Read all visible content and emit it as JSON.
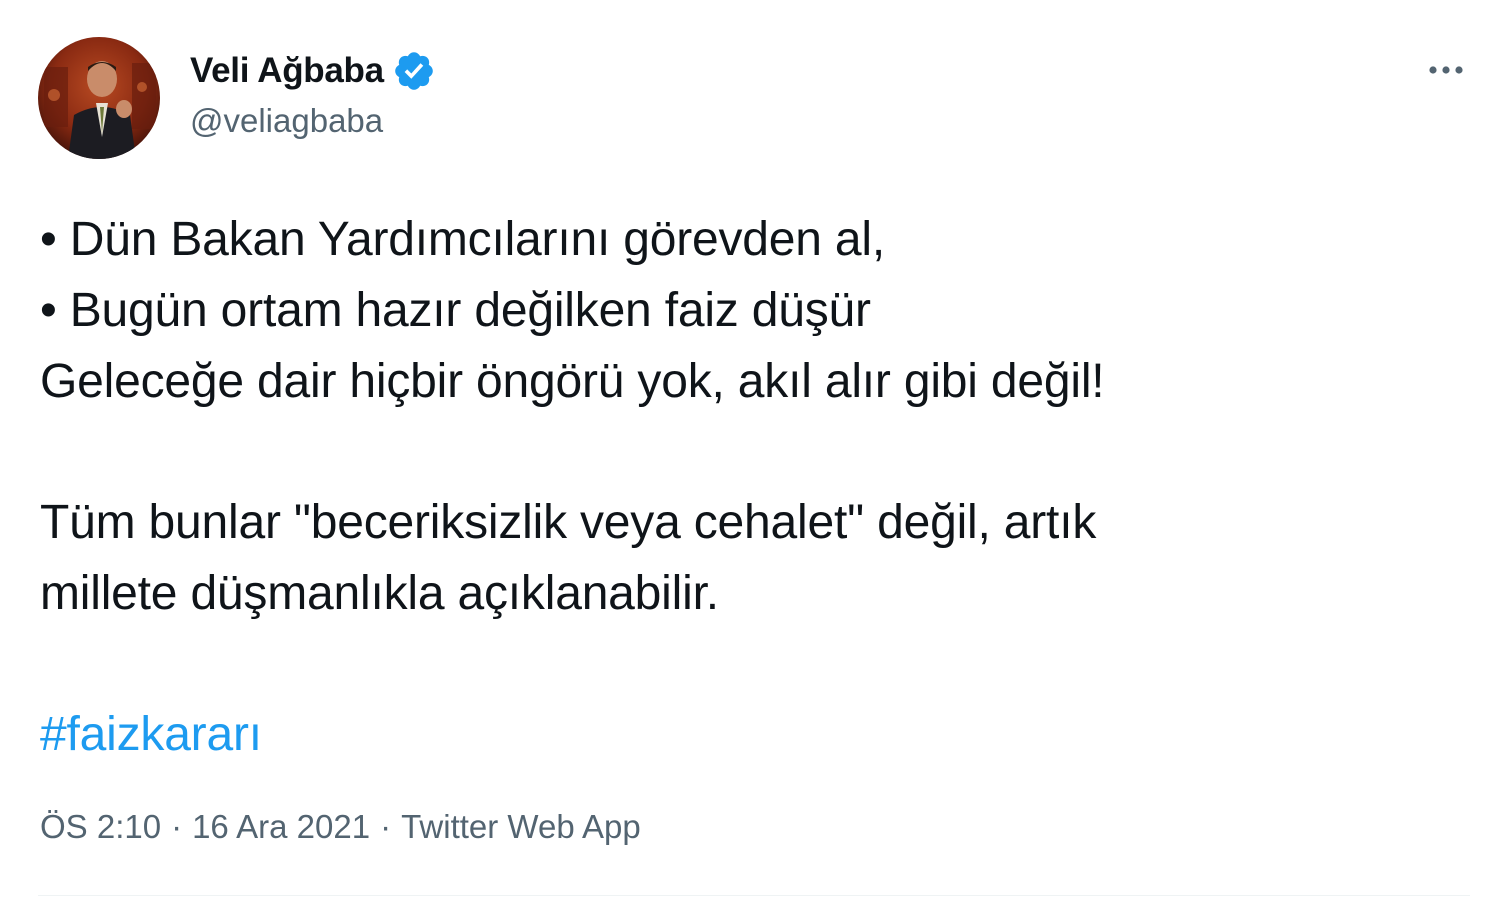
{
  "tweet": {
    "author": {
      "display_name": "Veli Ağbaba",
      "handle": "@veliagbaba",
      "verified": true,
      "verified_icon": "verified-badge-icon",
      "avatar": "profile-photo"
    },
    "more_icon": "more-horizontal-icon",
    "text_lines": [
      "• Dün Bakan Yardımcılarını görevden al,",
      "• Bugün ortam hazır değilken faiz düşür",
      "Geleceğe dair hiçbir öngörü yok, akıl alır gibi değil!",
      "Tüm bunlar \"beceriksizlik veya cehalet\" değil, artık",
      "millete düşmanlıkla açıklanabilir."
    ],
    "hashtag": "#faizkararı",
    "time": "ÖS 2:10",
    "separator": "·",
    "date": "16 Ara 2021",
    "source": "Twitter Web App"
  },
  "colors": {
    "text": "#0f1419",
    "secondary": "#536471",
    "accent": "#1d9bf0",
    "divider": "#eff3f4"
  }
}
